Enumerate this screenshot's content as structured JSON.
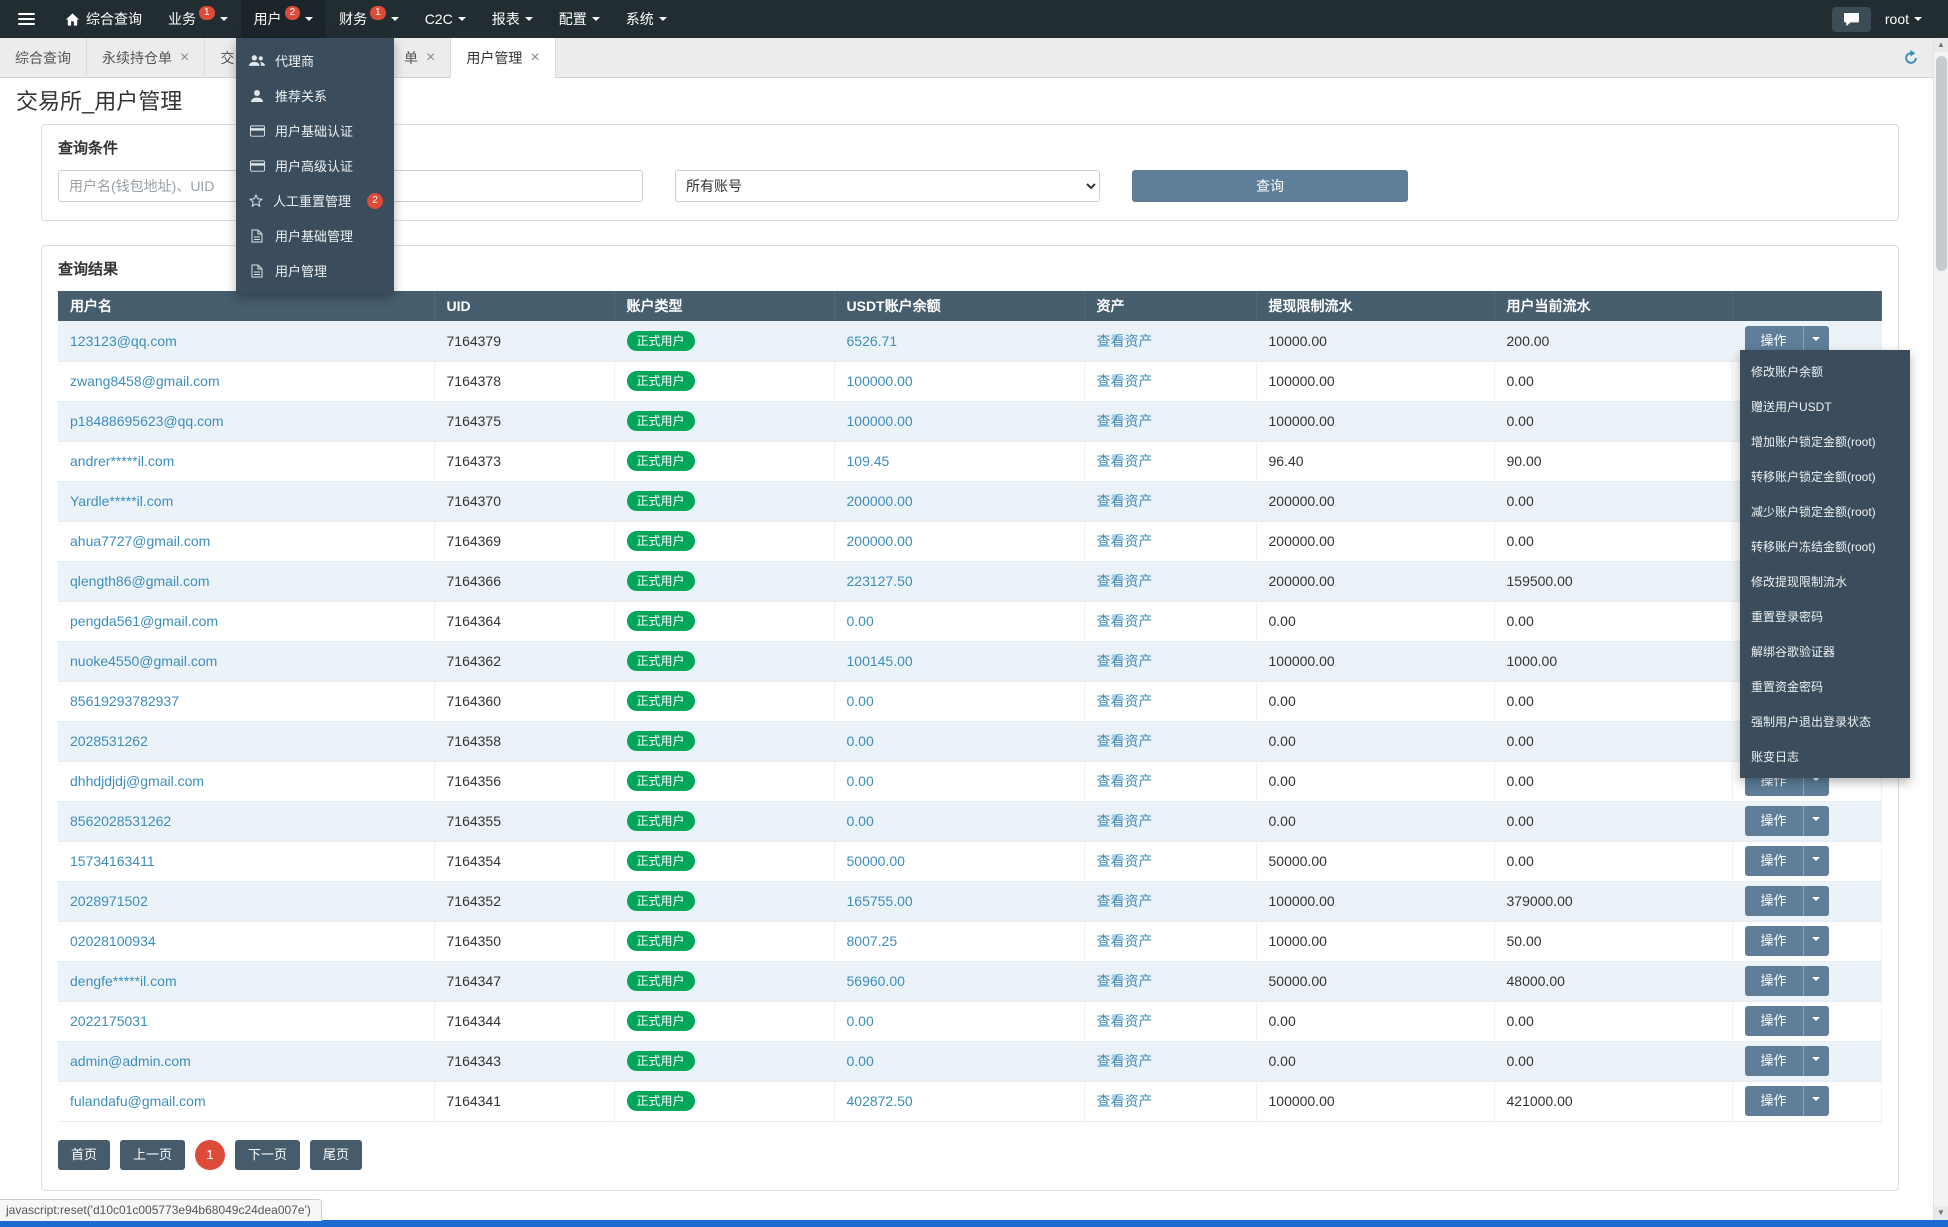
{
  "navbar": {
    "user": {
      "name": "root"
    },
    "items": [
      {
        "name": "overview",
        "label": "综合查询",
        "icon": "home"
      },
      {
        "name": "business",
        "label": "业务",
        "badge": "1",
        "caret": true
      },
      {
        "name": "user",
        "label": "用户",
        "badge": "2",
        "caret": true,
        "active": true
      },
      {
        "name": "finance",
        "label": "财务",
        "badge": "1",
        "caret": true
      },
      {
        "name": "c2c",
        "label": "C2C",
        "caret": true
      },
      {
        "name": "report",
        "label": "报表",
        "caret": true
      },
      {
        "name": "config",
        "label": "配置",
        "caret": true
      },
      {
        "name": "system",
        "label": "系统",
        "caret": true
      }
    ]
  },
  "user_menu": {
    "items": [
      {
        "name": "agents",
        "label": "代理商",
        "icon": "users"
      },
      {
        "name": "referrals",
        "label": "推荐关系",
        "icon": "user"
      },
      {
        "name": "basic-kyc",
        "label": "用户基础认证",
        "icon": "card"
      },
      {
        "name": "advanced-kyc",
        "label": "用户高级认证",
        "icon": "card"
      },
      {
        "name": "manual-reset",
        "label": "人工重置管理",
        "icon": "star",
        "badge": "2"
      },
      {
        "name": "user-base-mgmt",
        "label": "用户基础管理",
        "icon": "file"
      },
      {
        "name": "user-mgmt",
        "label": "用户管理",
        "icon": "file"
      }
    ]
  },
  "tabs": [
    {
      "name": "overview",
      "label": "综合查询",
      "closable": false
    },
    {
      "name": "perpetual",
      "label": "永续持仓单",
      "closable": true
    },
    {
      "name": "hidden-left",
      "label": "交",
      "closable": false
    },
    {
      "name": "hidden-right",
      "label": "单",
      "closable": true
    },
    {
      "name": "user-mgmt",
      "label": "用户管理",
      "closable": true,
      "active": true
    }
  ],
  "page": {
    "title": "交易所_用户管理"
  },
  "query_panel": {
    "title": "查询条件",
    "keyword_placeholder": "用户名(钱包地址)、UID",
    "account_select_value": "所有账号",
    "search_label": "查询"
  },
  "results": {
    "title": "查询结果",
    "table": {
      "headers": [
        "用户名",
        "UID",
        "账户类型",
        "USDT账户余额",
        "资产",
        "提现限制流水",
        "用户当前流水",
        ""
      ],
      "action_label": "操作",
      "rows": [
        {
          "username": "123123@qq.com",
          "uid": "7164379",
          "account_type": "正式用户",
          "usdt_balance": "6526.71",
          "assets": "查看资产",
          "withdraw_limit_flow": "10000.00",
          "current_flow": "200.00"
        },
        {
          "username": "zwang8458@gmail.com",
          "uid": "7164378",
          "account_type": "正式用户",
          "usdt_balance": "100000.00",
          "assets": "查看资产",
          "withdraw_limit_flow": "100000.00",
          "current_flow": "0.00"
        },
        {
          "username": "p18488695623@qq.com",
          "uid": "7164375",
          "account_type": "正式用户",
          "usdt_balance": "100000.00",
          "assets": "查看资产",
          "withdraw_limit_flow": "100000.00",
          "current_flow": "0.00"
        },
        {
          "username": "andrer*****il.com",
          "uid": "7164373",
          "account_type": "正式用户",
          "usdt_balance": "109.45",
          "assets": "查看资产",
          "withdraw_limit_flow": "96.40",
          "current_flow": "90.00"
        },
        {
          "username": "Yardle*****il.com",
          "uid": "7164370",
          "account_type": "正式用户",
          "usdt_balance": "200000.00",
          "assets": "查看资产",
          "withdraw_limit_flow": "200000.00",
          "current_flow": "0.00"
        },
        {
          "username": "ahua7727@gmail.com",
          "uid": "7164369",
          "account_type": "正式用户",
          "usdt_balance": "200000.00",
          "assets": "查看资产",
          "withdraw_limit_flow": "200000.00",
          "current_flow": "0.00"
        },
        {
          "username": "qlength86@gmail.com",
          "uid": "7164366",
          "account_type": "正式用户",
          "usdt_balance": "223127.50",
          "assets": "查看资产",
          "withdraw_limit_flow": "200000.00",
          "current_flow": "159500.00"
        },
        {
          "username": "pengda561@gmail.com",
          "uid": "7164364",
          "account_type": "正式用户",
          "usdt_balance": "0.00",
          "assets": "查看资产",
          "withdraw_limit_flow": "0.00",
          "current_flow": "0.00"
        },
        {
          "username": "nuoke4550@gmail.com",
          "uid": "7164362",
          "account_type": "正式用户",
          "usdt_balance": "100145.00",
          "assets": "查看资产",
          "withdraw_limit_flow": "100000.00",
          "current_flow": "1000.00"
        },
        {
          "username": "85619293782937",
          "uid": "7164360",
          "account_type": "正式用户",
          "usdt_balance": "0.00",
          "assets": "查看资产",
          "withdraw_limit_flow": "0.00",
          "current_flow": "0.00"
        },
        {
          "username": "2028531262",
          "uid": "7164358",
          "account_type": "正式用户",
          "usdt_balance": "0.00",
          "assets": "查看资产",
          "withdraw_limit_flow": "0.00",
          "current_flow": "0.00"
        },
        {
          "username": "dhhdjdjdj@gmail.com",
          "uid": "7164356",
          "account_type": "正式用户",
          "usdt_balance": "0.00",
          "assets": "查看资产",
          "withdraw_limit_flow": "0.00",
          "current_flow": "0.00"
        },
        {
          "username": "8562028531262",
          "uid": "7164355",
          "account_type": "正式用户",
          "usdt_balance": "0.00",
          "assets": "查看资产",
          "withdraw_limit_flow": "0.00",
          "current_flow": "0.00"
        },
        {
          "username": "15734163411",
          "uid": "7164354",
          "account_type": "正式用户",
          "usdt_balance": "50000.00",
          "assets": "查看资产",
          "withdraw_limit_flow": "50000.00",
          "current_flow": "0.00"
        },
        {
          "username": "2028971502",
          "uid": "7164352",
          "account_type": "正式用户",
          "usdt_balance": "165755.00",
          "assets": "查看资产",
          "withdraw_limit_flow": "100000.00",
          "current_flow": "379000.00"
        },
        {
          "username": "02028100934",
          "uid": "7164350",
          "account_type": "正式用户",
          "usdt_balance": "8007.25",
          "assets": "查看资产",
          "withdraw_limit_flow": "10000.00",
          "current_flow": "50.00"
        },
        {
          "username": "dengfe*****il.com",
          "uid": "7164347",
          "account_type": "正式用户",
          "usdt_balance": "56960.00",
          "assets": "查看资产",
          "withdraw_limit_flow": "50000.00",
          "current_flow": "48000.00"
        },
        {
          "username": "2022175031",
          "uid": "7164344",
          "account_type": "正式用户",
          "usdt_balance": "0.00",
          "assets": "查看资产",
          "withdraw_limit_flow": "0.00",
          "current_flow": "0.00"
        },
        {
          "username": "admin@admin.com",
          "uid": "7164343",
          "account_type": "正式用户",
          "usdt_balance": "0.00",
          "assets": "查看资产",
          "withdraw_limit_flow": "0.00",
          "current_flow": "0.00"
        },
        {
          "username": "fulandafu@gmail.com",
          "uid": "7164341",
          "account_type": "正式用户",
          "usdt_balance": "402872.50",
          "assets": "查看资产",
          "withdraw_limit_flow": "100000.00",
          "current_flow": "421000.00"
        }
      ]
    },
    "pagination": [
      {
        "name": "first",
        "label": "首页"
      },
      {
        "name": "previous",
        "label": "上一页"
      },
      {
        "name": "page-1",
        "label": "1",
        "active": true
      },
      {
        "name": "next",
        "label": "下一页"
      },
      {
        "name": "last",
        "label": "尾页"
      }
    ]
  },
  "action_menu": {
    "items": [
      "修改账户余额",
      "赠送用户USDT",
      "增加账户锁定金额(root)",
      "转移账户锁定金额(root)",
      "减少账户锁定金额(root)",
      "转移账户冻结金额(root)",
      "修改提现限制流水",
      "重置登录密码",
      "解绑谷歌验证器",
      "重置资金密码",
      "强制用户退出登录状态",
      "账变日志"
    ],
    "colors_note": "item_count_12"
  },
  "status_bar": {
    "text": "javascript:reset('d10c01c005773e94b68049c24dea007e')"
  },
  "colors": {
    "navbar_bg": "#222d32",
    "accent_blue": "#3c8dbc",
    "badge_red": "#dd4b39",
    "success_green": "#00a65a",
    "steel_button": "#5e7e99",
    "table_header": "#455d6d",
    "dropdown_bg": "#3b4d5c"
  }
}
